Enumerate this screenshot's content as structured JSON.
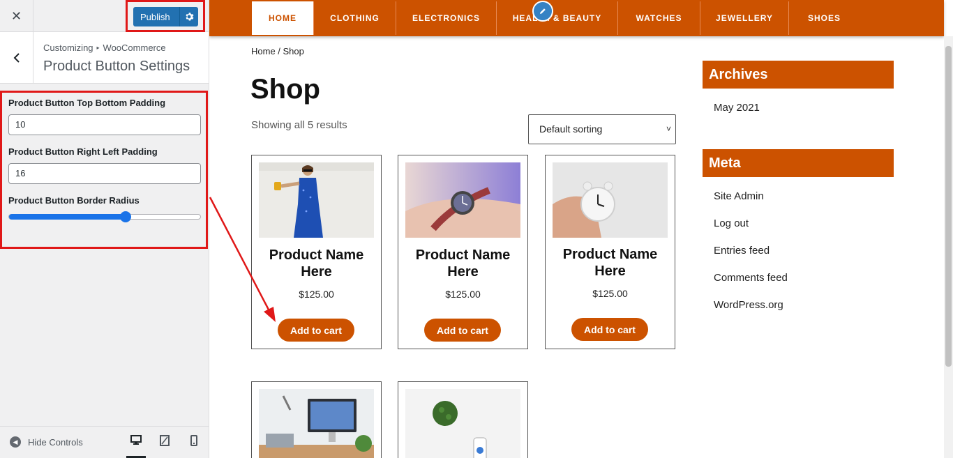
{
  "sidebar": {
    "close_icon": "close-icon",
    "publish_label": "Publish",
    "breadcrumb": {
      "part1": "Customizing",
      "part2": "WooCommerce"
    },
    "section_title": "Product Button Settings",
    "controls": {
      "top_bottom_label": "Product Button Top Bottom Padding",
      "top_bottom_value": "10",
      "right_left_label": "Product Button Right Left Padding",
      "right_left_value": "16",
      "border_radius_label": "Product Button Border Radius",
      "border_radius_fraction": 0.61
    },
    "footer": {
      "hide_controls": "Hide Controls"
    }
  },
  "nav": {
    "items": [
      "HOME",
      "CLOTHING",
      "ELECTRONICS",
      "HEALTH & BEAUTY",
      "WATCHES",
      "JEWELLERY",
      "SHOES"
    ]
  },
  "shop": {
    "breadcrumb": "Home / Shop",
    "title": "Shop",
    "result_count": "Showing all 5 results",
    "sort_selected": "Default sorting",
    "products": [
      {
        "name": "Product Name Here",
        "price": "$125.00",
        "cart_label": "Add to cart"
      },
      {
        "name": "Product Name Here",
        "price": "$125.00",
        "cart_label": "Add to cart"
      },
      {
        "name": "Product Name Here",
        "price": "$125.00",
        "cart_label": "Add to cart"
      }
    ]
  },
  "widgets": {
    "archives_title": "Archives",
    "archives": [
      "May 2021"
    ],
    "meta_title": "Meta",
    "meta": [
      "Site Admin",
      "Log out",
      "Entries feed",
      "Comments feed",
      "WordPress.org"
    ]
  },
  "colors": {
    "accent": "#cc5200",
    "wp_blue": "#2271b1",
    "slider_blue": "#1a73e8",
    "annotation_red": "#e01818"
  }
}
